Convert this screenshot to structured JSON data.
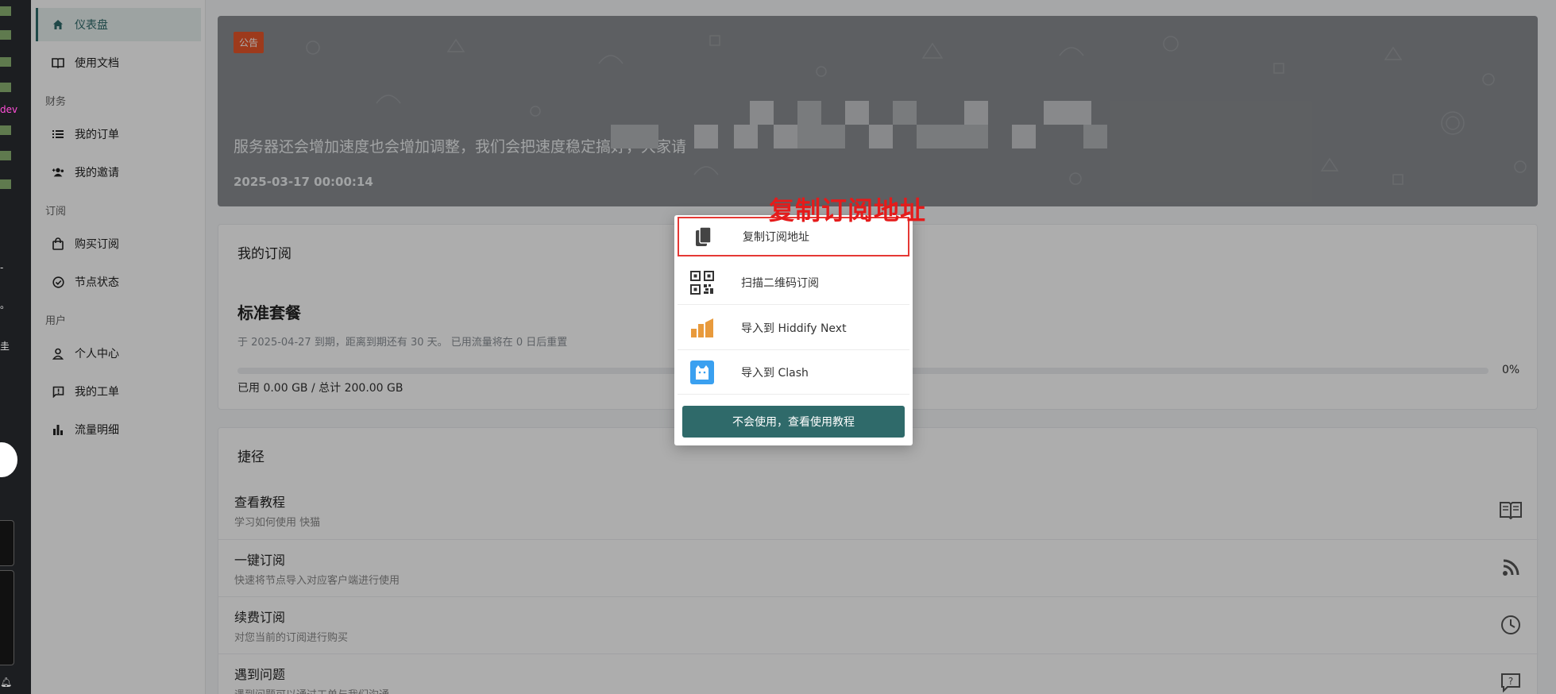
{
  "sidebar": {
    "items": [
      {
        "label": "仪表盘"
      },
      {
        "label": "使用文档"
      },
      {
        "label": "我的订单"
      },
      {
        "label": "我的邀请"
      },
      {
        "label": "购买订阅"
      },
      {
        "label": "节点状态"
      },
      {
        "label": "个人中心"
      },
      {
        "label": "我的工单"
      },
      {
        "label": "流量明细"
      }
    ],
    "sections": {
      "finance": "财务",
      "subscription": "订阅",
      "user": "用户"
    }
  },
  "announcement": {
    "badge": "公告",
    "text": "服务器还会增加速度也会增加调整，我们会把速度稳定搞好，大家请",
    "date": "2025-03-17 00:00:14"
  },
  "subscription": {
    "title": "我的订阅",
    "plan_name": "标准套餐",
    "description": "于 2025-04-27 到期，距离到期还有 30 天。 已用流量将在 0 日后重置",
    "usage_percent": 0,
    "percent_label": "0%",
    "usage_text": "已用 0.00 GB / 总计 200.00 GB"
  },
  "shortcuts": {
    "title": "捷径",
    "items": [
      {
        "title": "查看教程",
        "desc": "学习如何使用 快猫"
      },
      {
        "title": "一键订阅",
        "desc": "快速将节点导入对应客户端进行使用"
      },
      {
        "title": "续费订阅",
        "desc": "对您当前的订阅进行购买"
      },
      {
        "title": "遇到问题",
        "desc": "遇到问题可以通过工单与我们沟通"
      }
    ]
  },
  "popup": {
    "options": [
      {
        "label": "复制订阅地址"
      },
      {
        "label": "扫描二维码订阅"
      },
      {
        "label": "导入到 Hiddify Next"
      },
      {
        "label": "导入到 Clash"
      }
    ],
    "help_button": "不会使用，查看使用教程"
  },
  "annotation": "复制订阅地址",
  "colors": {
    "accent": "#2f6a6a",
    "badge": "#e8562a",
    "highlight": "#e53935"
  }
}
